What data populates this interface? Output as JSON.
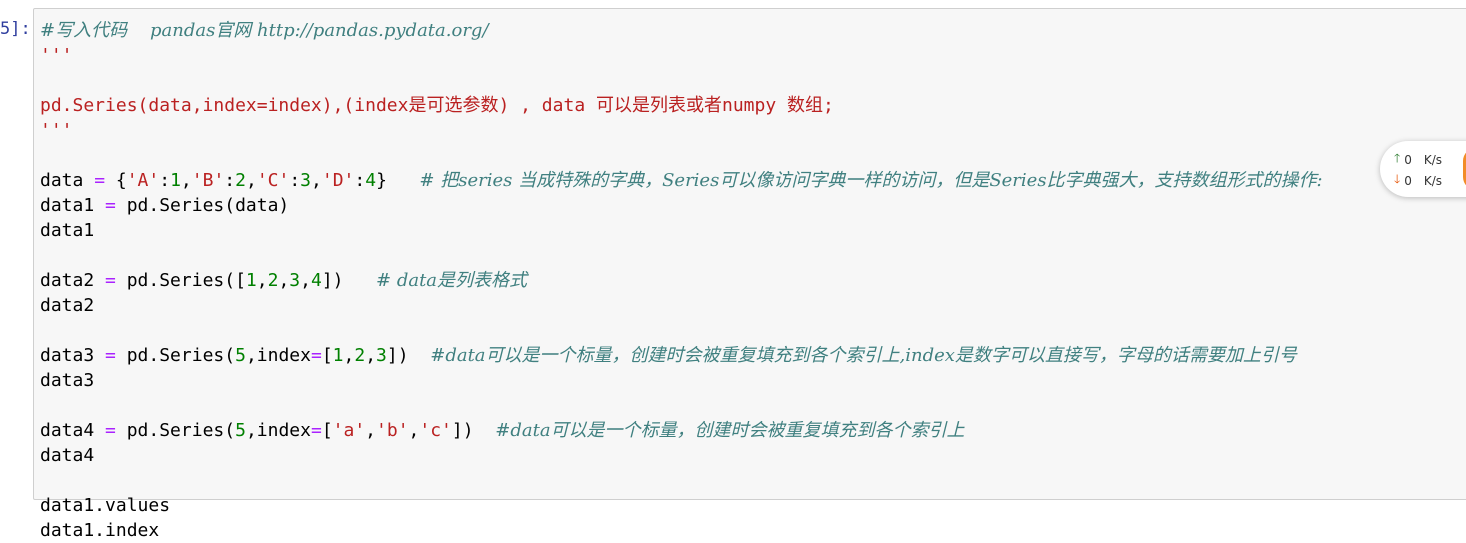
{
  "prompt": "5]:",
  "code_lines": [
    {
      "parts": [
        {
          "t": "#写入代码    pandas官网 http://pandas.pydata.org/",
          "c": "cm"
        }
      ]
    },
    {
      "parts": [
        {
          "t": "'''",
          "c": "q"
        }
      ]
    },
    {
      "parts": []
    },
    {
      "parts": [
        {
          "t": "pd.Series(data,index=index),(index是可选参数) , data 可以是列表或者numpy 数组;",
          "c": "str"
        }
      ]
    },
    {
      "parts": [
        {
          "t": "'''",
          "c": "q"
        }
      ]
    },
    {
      "parts": []
    },
    {
      "parts": [
        {
          "t": "data ",
          "c": ""
        },
        {
          "t": "=",
          "c": "op"
        },
        {
          "t": " {",
          "c": ""
        },
        {
          "t": "'A'",
          "c": "str"
        },
        {
          "t": ":",
          "c": ""
        },
        {
          "t": "1",
          "c": "num"
        },
        {
          "t": ",",
          "c": ""
        },
        {
          "t": "'B'",
          "c": "str"
        },
        {
          "t": ":",
          "c": ""
        },
        {
          "t": "2",
          "c": "num"
        },
        {
          "t": ",",
          "c": ""
        },
        {
          "t": "'C'",
          "c": "str"
        },
        {
          "t": ":",
          "c": ""
        },
        {
          "t": "3",
          "c": "num"
        },
        {
          "t": ",",
          "c": ""
        },
        {
          "t": "'D'",
          "c": "str"
        },
        {
          "t": ":",
          "c": ""
        },
        {
          "t": "4",
          "c": "num"
        },
        {
          "t": "}   ",
          "c": ""
        },
        {
          "t": "# 把series 当成特殊的字典，Series可以像访问字典一样的访问，但是Series比字典强大，支持数组形式的操作:",
          "c": "cm"
        }
      ]
    },
    {
      "parts": [
        {
          "t": "data1 ",
          "c": ""
        },
        {
          "t": "=",
          "c": "op"
        },
        {
          "t": " pd.Series(data)",
          "c": ""
        }
      ]
    },
    {
      "parts": [
        {
          "t": "data1",
          "c": ""
        }
      ]
    },
    {
      "parts": []
    },
    {
      "parts": [
        {
          "t": "data2 ",
          "c": ""
        },
        {
          "t": "=",
          "c": "op"
        },
        {
          "t": " pd.Series([",
          "c": ""
        },
        {
          "t": "1",
          "c": "num"
        },
        {
          "t": ",",
          "c": ""
        },
        {
          "t": "2",
          "c": "num"
        },
        {
          "t": ",",
          "c": ""
        },
        {
          "t": "3",
          "c": "num"
        },
        {
          "t": ",",
          "c": ""
        },
        {
          "t": "4",
          "c": "num"
        },
        {
          "t": "])   ",
          "c": ""
        },
        {
          "t": "# data是列表格式",
          "c": "cm"
        }
      ]
    },
    {
      "parts": [
        {
          "t": "data2",
          "c": ""
        }
      ]
    },
    {
      "parts": []
    },
    {
      "parts": [
        {
          "t": "data3 ",
          "c": ""
        },
        {
          "t": "=",
          "c": "op"
        },
        {
          "t": " pd.Series(",
          "c": ""
        },
        {
          "t": "5",
          "c": "num"
        },
        {
          "t": ",index",
          "c": ""
        },
        {
          "t": "=",
          "c": "op"
        },
        {
          "t": "[",
          "c": ""
        },
        {
          "t": "1",
          "c": "num"
        },
        {
          "t": ",",
          "c": ""
        },
        {
          "t": "2",
          "c": "num"
        },
        {
          "t": ",",
          "c": ""
        },
        {
          "t": "3",
          "c": "num"
        },
        {
          "t": "])  ",
          "c": ""
        },
        {
          "t": "#data可以是一个标量，创建时会被重复填充到各个索引上,index是数字可以直接写，字母的话需要加上引号",
          "c": "cm"
        }
      ]
    },
    {
      "parts": [
        {
          "t": "data3",
          "c": ""
        }
      ]
    },
    {
      "parts": []
    },
    {
      "parts": [
        {
          "t": "data4 ",
          "c": ""
        },
        {
          "t": "=",
          "c": "op"
        },
        {
          "t": " pd.Series(",
          "c": ""
        },
        {
          "t": "5",
          "c": "num"
        },
        {
          "t": ",index",
          "c": ""
        },
        {
          "t": "=",
          "c": "op"
        },
        {
          "t": "[",
          "c": ""
        },
        {
          "t": "'a'",
          "c": "str"
        },
        {
          "t": ",",
          "c": ""
        },
        {
          "t": "'b'",
          "c": "str"
        },
        {
          "t": ",",
          "c": ""
        },
        {
          "t": "'c'",
          "c": "str"
        },
        {
          "t": "])  ",
          "c": ""
        },
        {
          "t": "#data可以是一个标量，创建时会被重复填充到各个索引上",
          "c": "cm"
        }
      ]
    },
    {
      "parts": [
        {
          "t": "data4",
          "c": ""
        }
      ]
    },
    {
      "parts": []
    },
    {
      "parts": [
        {
          "t": "data1.values",
          "c": ""
        }
      ]
    },
    {
      "parts": [
        {
          "t": "data1.index",
          "c": ""
        }
      ]
    }
  ],
  "network_widget": {
    "upload_value": "0",
    "upload_unit": "K/s",
    "download_value": "0",
    "download_unit": "K/s",
    "up_icon": "arrow-up-icon",
    "down_icon": "arrow-down-icon",
    "up_color": "#2e7d32",
    "down_color": "#e65100"
  }
}
